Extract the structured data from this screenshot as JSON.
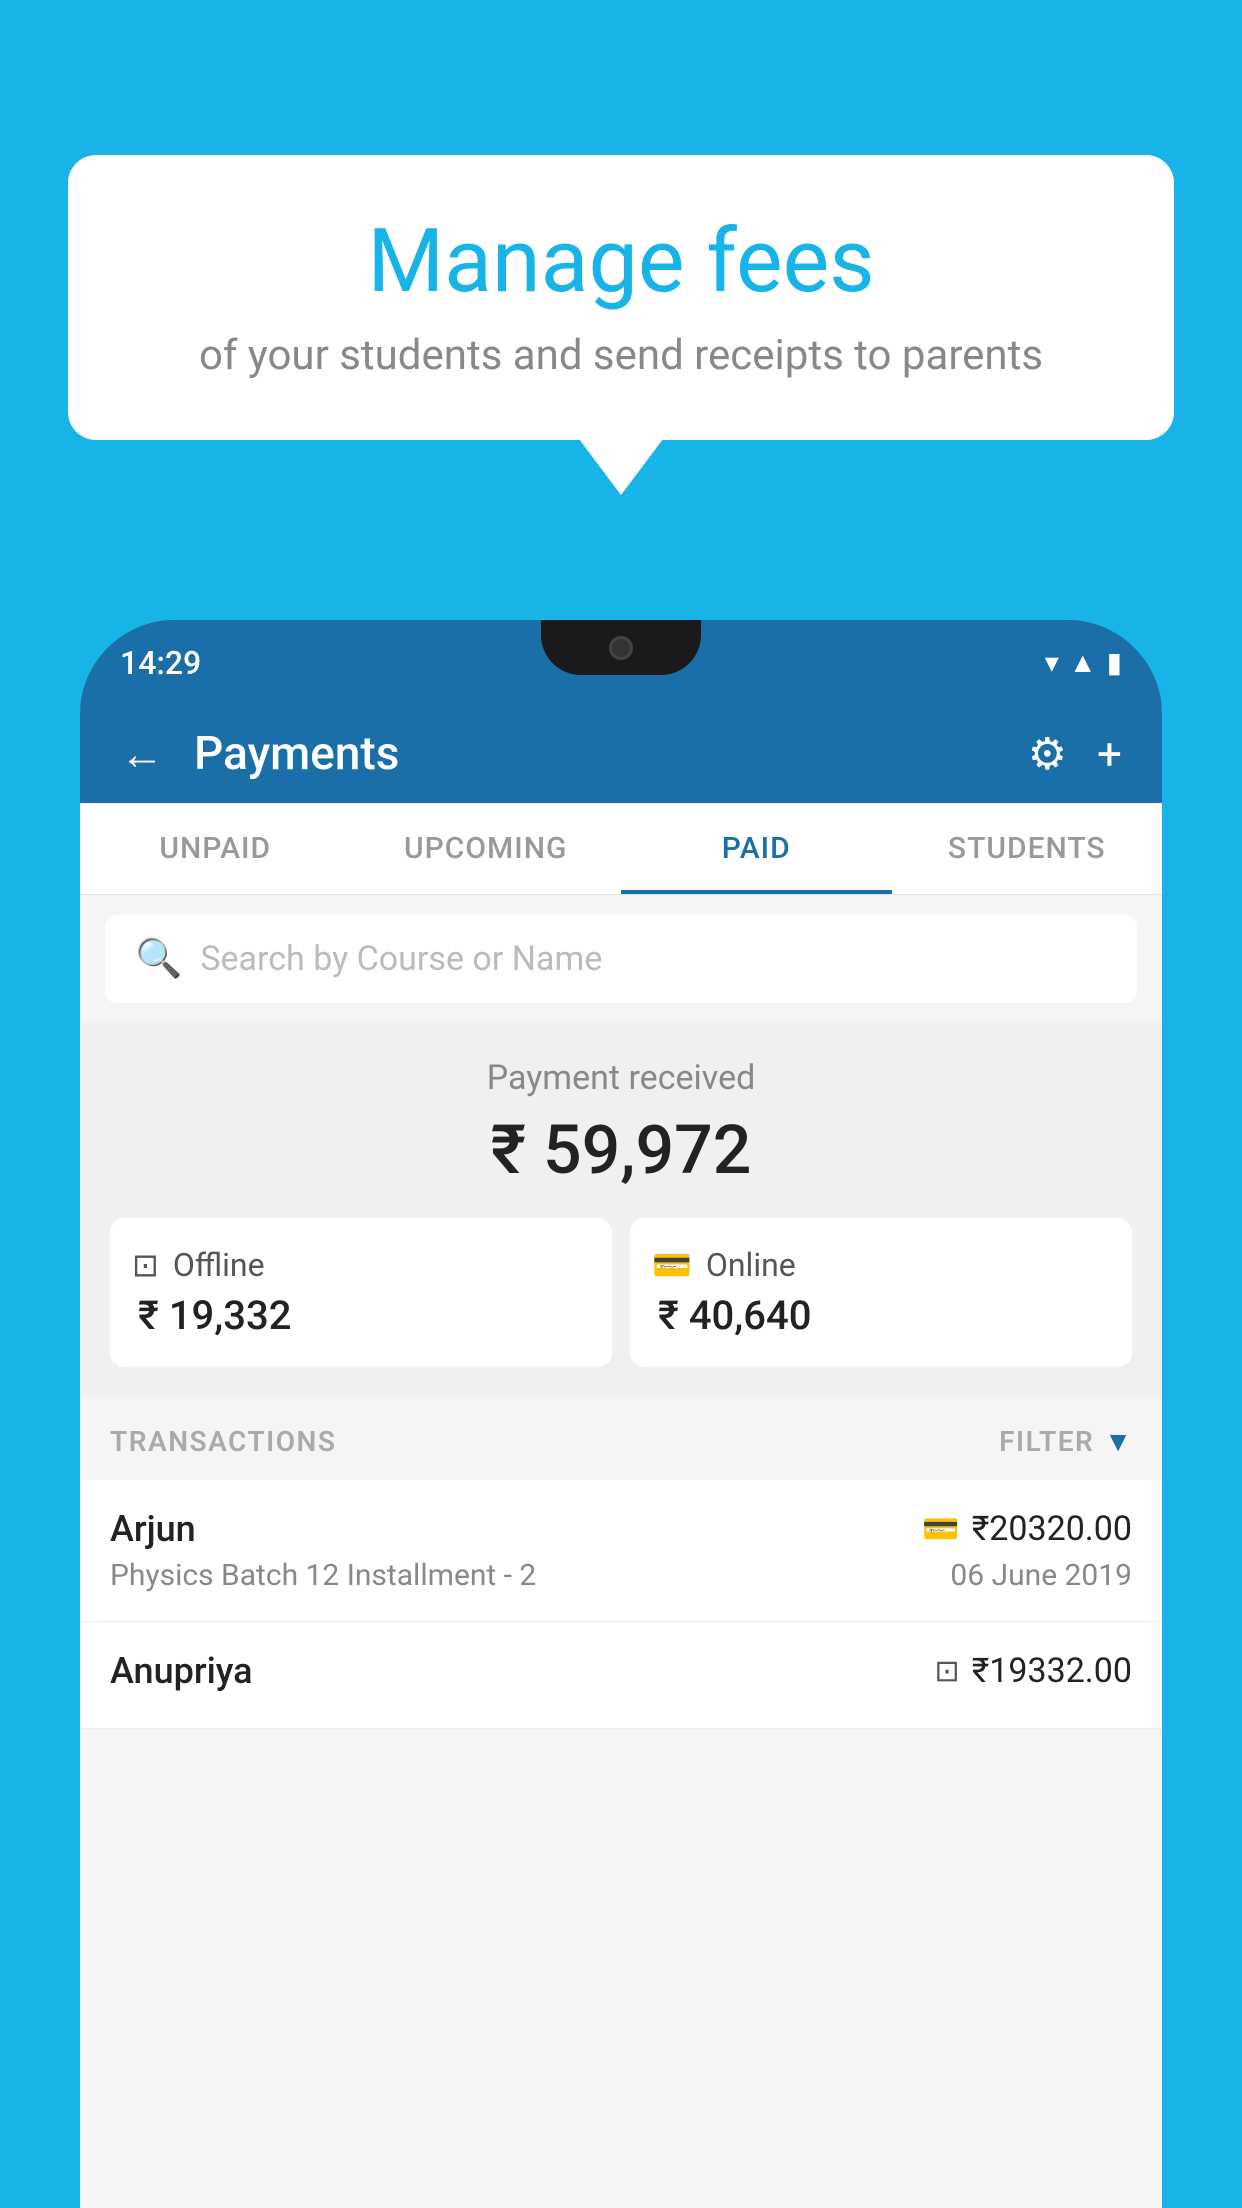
{
  "background_color": "#18B4E8",
  "speech_bubble": {
    "title": "Manage fees",
    "subtitle": "of your students and send receipts to parents"
  },
  "phone": {
    "status_bar": {
      "time": "14:29",
      "wifi": "▾",
      "signal": "▲",
      "battery": "▮"
    },
    "header": {
      "back_label": "←",
      "title": "Payments",
      "gear_label": "⚙",
      "plus_label": "+"
    },
    "tabs": [
      {
        "label": "UNPAID",
        "active": false
      },
      {
        "label": "UPCOMING",
        "active": false
      },
      {
        "label": "PAID",
        "active": true
      },
      {
        "label": "STUDENTS",
        "active": false
      }
    ],
    "search": {
      "placeholder": "Search by Course or Name"
    },
    "payment_summary": {
      "label": "Payment received",
      "amount": "₹ 59,972",
      "offline_label": "Offline",
      "offline_amount": "₹ 19,332",
      "online_label": "Online",
      "online_amount": "₹ 40,640"
    },
    "transactions_section": {
      "label": "TRANSACTIONS",
      "filter_label": "FILTER",
      "rows": [
        {
          "name": "Arjun",
          "amount": "₹20320.00",
          "course": "Physics Batch 12 Installment - 2",
          "date": "06 June 2019",
          "payment_type": "online"
        },
        {
          "name": "Anupriya",
          "amount": "₹19332.00",
          "course": "",
          "date": "",
          "payment_type": "offline"
        }
      ]
    }
  }
}
